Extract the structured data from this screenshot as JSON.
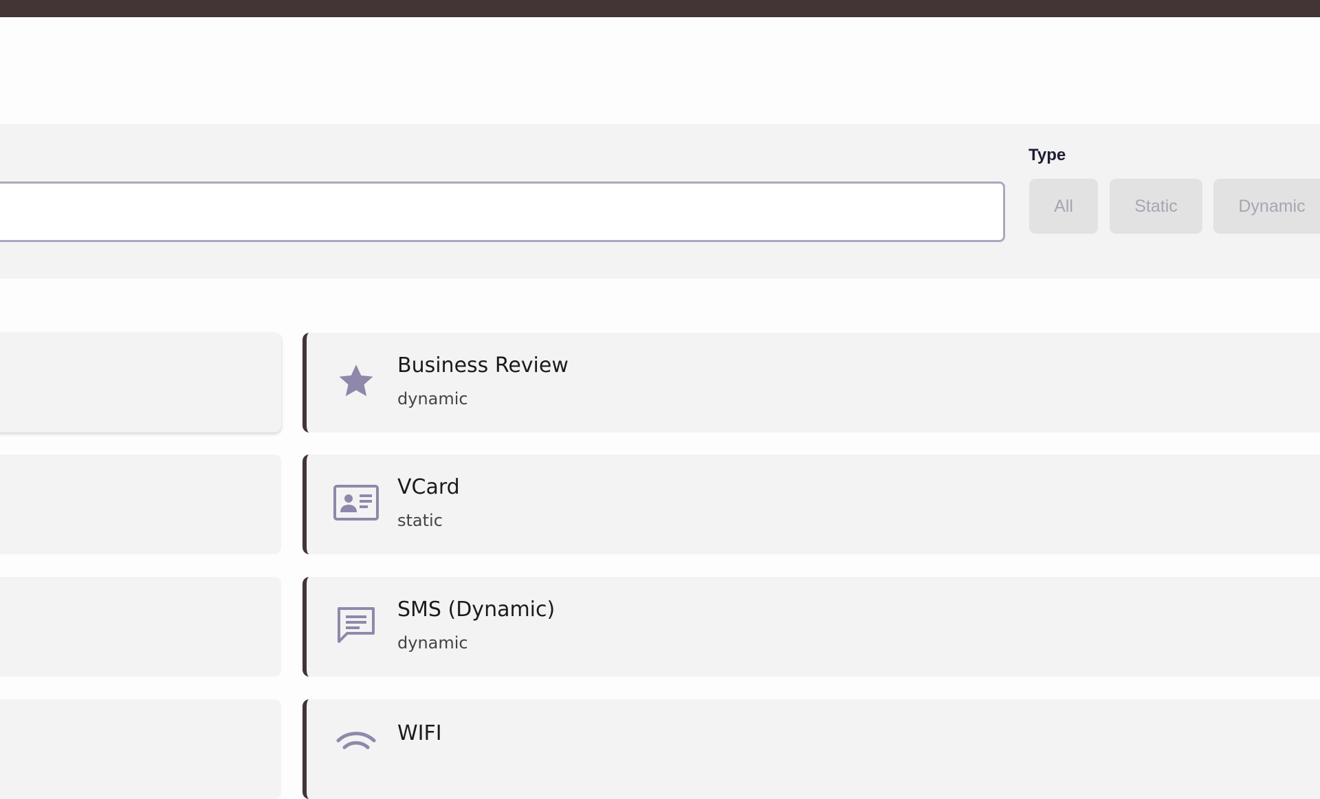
{
  "filter": {
    "type_label": "Type",
    "type_options": [
      "All",
      "Static",
      "Dynamic"
    ]
  },
  "qr_types": [
    {
      "title": "Business Review",
      "subtitle": "dynamic",
      "icon": "star-icon"
    },
    {
      "title": "VCard",
      "subtitle": "static",
      "icon": "contact-card-icon"
    },
    {
      "title": "SMS (Dynamic)",
      "subtitle": "dynamic",
      "icon": "message-icon"
    },
    {
      "title": "WIFI",
      "subtitle": "",
      "icon": "wifi-icon"
    }
  ],
  "colors": {
    "topbar": "#433436",
    "accent_border": "#433436",
    "icon": "#8f88ab",
    "input_border": "#aca7bf"
  }
}
